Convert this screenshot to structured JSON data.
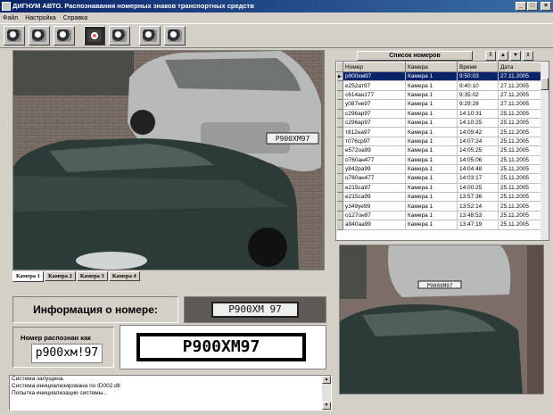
{
  "window": {
    "title": "ДИГНУМ АВТО. Распознавания номерных знаков транспортных средств"
  },
  "menu": [
    "Файл",
    "Настройка",
    "Справка"
  ],
  "toolbar": {
    "buttons": [
      "gear-tool",
      "gear-camera-tool",
      "tools-tool",
      "camera-active-tool",
      "camera-settings-tool",
      "edit-tool",
      "exit-tool"
    ]
  },
  "camera_tabs": [
    "Камера 1",
    "Камера 2",
    "Камера 3",
    "Камера 4"
  ],
  "info": {
    "title": "Информация о номере:",
    "recognized_label": "Номер распознан как",
    "recognized_value": "р900хм!97",
    "plate_crop_text": "Р900ХМ 97",
    "binarized_text": "Р900ХМ97"
  },
  "log": [
    "Система запущена.",
    "Система инициализирована по ID002.dll",
    "Попытка инициализации системы..."
  ],
  "list": {
    "title": "Список номеров",
    "nav": [
      "⊼",
      "▲",
      "▼",
      "⊻"
    ],
    "columns": [
      "Номер",
      "Камера",
      "Время",
      "Дата"
    ],
    "rows": [
      [
        "р900хм97",
        "Камера 1",
        "9:50:03",
        "27.11.2005"
      ],
      [
        "е252ат97",
        "Камера 1",
        "9:40:10",
        "27.11.2005"
      ],
      [
        "с614ан177",
        "Камера 1",
        "9:35:02",
        "27.11.2005"
      ],
      [
        "у087не97",
        "Камера 1",
        "9:29:28",
        "27.11.2005"
      ],
      [
        "с296ар97",
        "Камера 1",
        "14:10:31",
        "25.11.2005"
      ],
      [
        "с296ар97",
        "Камера 1",
        "14:10:25",
        "25.11.2005"
      ],
      [
        "т812на97",
        "Камера 1",
        "14:09:42",
        "25.11.2005"
      ],
      [
        "т076ср97",
        "Камера 1",
        "14:07:24",
        "25.11.2005"
      ],
      [
        "е572оа99",
        "Камера 1",
        "14:05:25",
        "25.11.2005"
      ],
      [
        "о760ан477",
        "Камера 1",
        "14:05:06",
        "25.11.2005"
      ],
      [
        "у842ра99",
        "Камера 1",
        "14:04:48",
        "25.11.2005"
      ],
      [
        "о760ан477",
        "Камера 1",
        "14:03:17",
        "25.11.2005"
      ],
      [
        "е215ca97",
        "Камера 1",
        "14:00:25",
        "25.11.2005"
      ],
      [
        "е215са99",
        "Камера 1",
        "13:57:36",
        "25.11.2005"
      ],
      [
        "у349уе99",
        "Камера 1",
        "13:52:14",
        "25.11.2005"
      ],
      [
        "о127он97",
        "Камера 1",
        "13:48:53",
        "25.11.2005"
      ],
      [
        "а940аа99",
        "Камера 1",
        "13:47:19",
        "25.11.2005"
      ]
    ],
    "selected_index": 0
  }
}
